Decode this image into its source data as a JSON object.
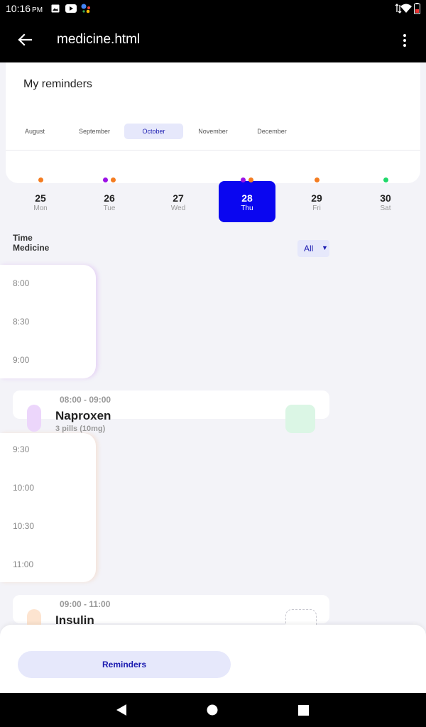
{
  "status_bar": {
    "time": "10:16",
    "ampm": "PM"
  },
  "app_bar": {
    "title": "medicine.html"
  },
  "reminders_card": {
    "title": "My reminders",
    "months": [
      "August",
      "September",
      "October",
      "November",
      "December"
    ],
    "selected_month": "October"
  },
  "days": [
    {
      "num": "25",
      "wd": "Mon",
      "dots": [
        "#f47c20"
      ]
    },
    {
      "num": "26",
      "wd": "Tue",
      "dots": [
        "#9b12e6",
        "#f47c20"
      ]
    },
    {
      "num": "27",
      "wd": "Wed",
      "dots": []
    },
    {
      "num": "28",
      "wd": "Thu",
      "dots": [
        "#9b12e6",
        "#f47c20"
      ],
      "selected": true
    },
    {
      "num": "29",
      "wd": "Fri",
      "dots": [
        "#f47c20"
      ]
    },
    {
      "num": "30",
      "wd": "Sat",
      "dots": [
        "#1fd86a"
      ]
    }
  ],
  "schedule": {
    "header_time": "Time",
    "header_medicine": "Medicine",
    "filter_value": "All",
    "time_labels": [
      "8:00",
      "8:30",
      "9:00",
      "9:30",
      "10:00",
      "10:30",
      "11:00"
    ]
  },
  "medications": [
    {
      "time": "08:00 - 09:00",
      "name": "Naproxen",
      "dose": "3 pills (10mg)",
      "pill_color": "#ecd6fb",
      "check_color": "#dbf6e5"
    },
    {
      "time": "09:00 - 11:00",
      "name": "Insulin",
      "dose": "",
      "pill_color": "#fde4d0",
      "check_color": "dashed"
    }
  ],
  "bottom_bar": {
    "reminders_label": "Reminders"
  },
  "colors": {
    "accent": "#0a06f0",
    "purple": "#9b12e6",
    "orange": "#f47c20",
    "green": "#1fd86a",
    "tint": "#e6e8fb"
  }
}
